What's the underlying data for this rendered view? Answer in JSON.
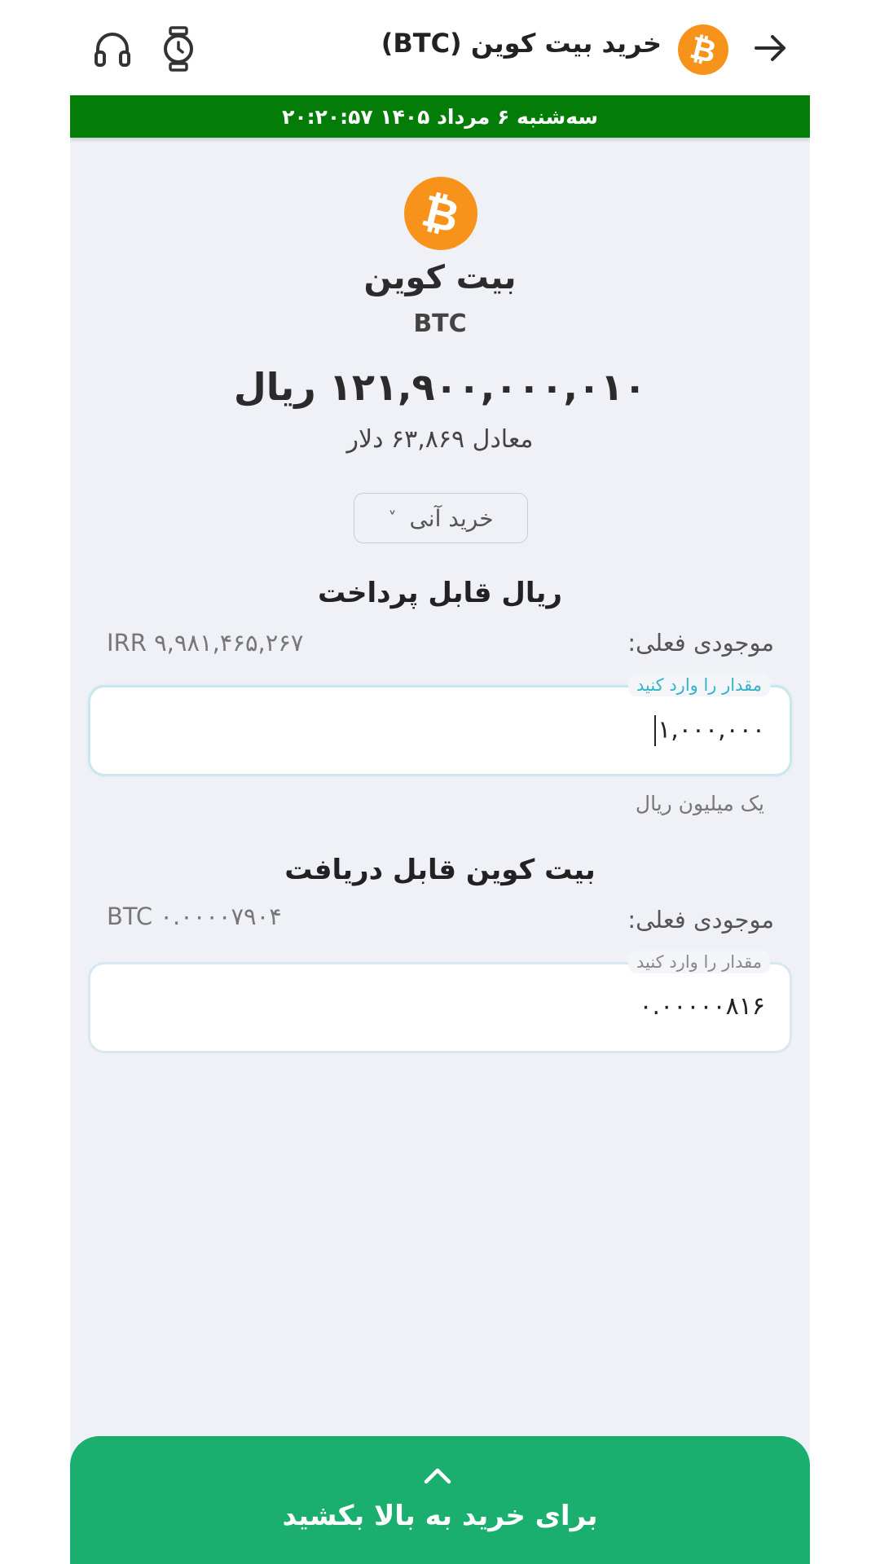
{
  "header": {
    "title": "خرید بیت کوین (BTC)",
    "icons": [
      "back-arrow-icon",
      "bitcoin-icon",
      "watch-icon",
      "headset-icon"
    ]
  },
  "datebar": {
    "text": "سه‌شنبه ۶ مرداد ۱۴۰۵ ۲۰:۲۰:۵۷"
  },
  "coin": {
    "symbol_glyph": "₿",
    "name": "بیت کوین",
    "symbol": "BTC",
    "price": "۱۲۱,۹۰۰,۰۰۰,۰۱۰ ریال",
    "usd": "معادل ۶۳,۸۶۹ دلار"
  },
  "order_type": {
    "selected": "خرید آنی",
    "chevron": "˅"
  },
  "pay": {
    "title": "ریال قابل پرداخت",
    "balance_label": "موجودی فعلی:",
    "balance_value": "IRR ۹,۹۸۱,۴۶۵,۲۶۷",
    "input_label": "مقدار را وارد کنید",
    "input_value": "۱,۰۰۰,۰۰۰",
    "hint": "یک میلیون ریال"
  },
  "receive": {
    "title": "بیت کوین قابل دریافت",
    "balance_label": "موجودی فعلی:",
    "balance_value": "BTC ۰.۰۰۰۰۷۹۰۴",
    "input_label": "مقدار را وارد کنید",
    "input_value": "۰.۰۰۰۰۰۸۱۶"
  },
  "swipe": {
    "label": "برای خرید به بالا بکشید"
  },
  "colors": {
    "date_bar": "#047d08",
    "bitcoin_orange": "#f7931a",
    "swipe_green": "#1aae6f",
    "background": "#eff1f7",
    "input_label_teal": "#34b3c9"
  }
}
